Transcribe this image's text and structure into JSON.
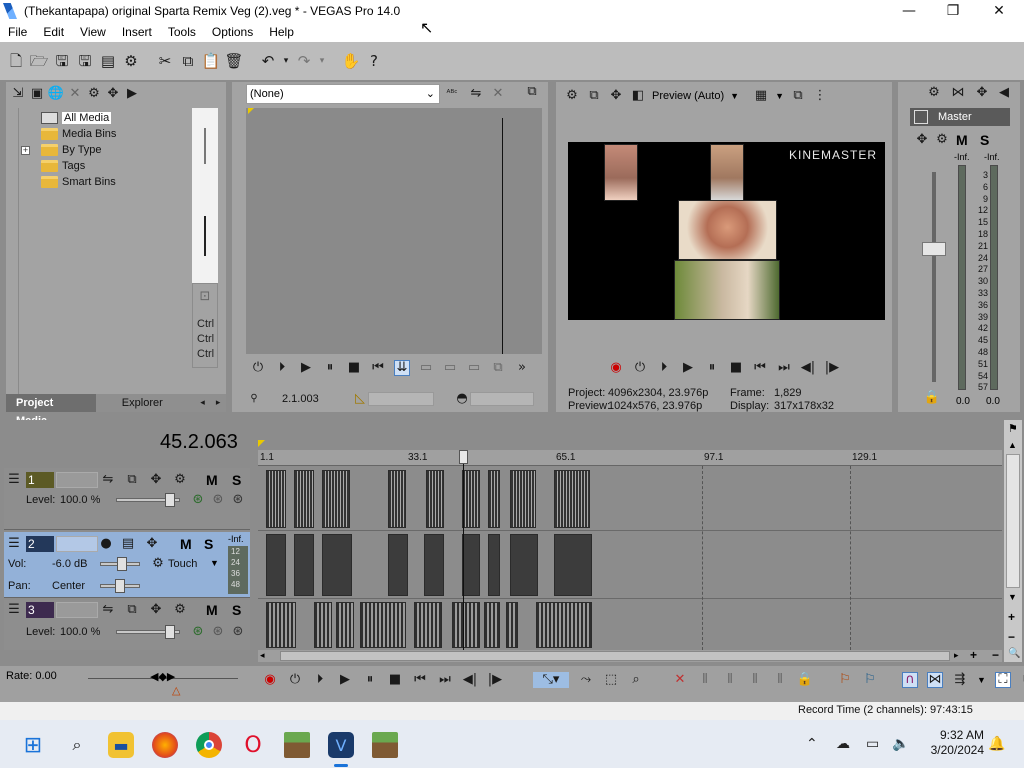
{
  "window": {
    "title": "(Thekantapapa) original Sparta Remix Veg (2).veg * - VEGAS Pro 14.0",
    "minimize": "—",
    "maximize": "❐",
    "close": "✕"
  },
  "menu": [
    "File",
    "Edit",
    "View",
    "Insert",
    "Tools",
    "Options",
    "Help"
  ],
  "toolbar_icons": [
    "new-icon",
    "open-icon",
    "save-icon",
    "save-as-icon",
    "render-icon",
    "properties-icon",
    "cut-icon",
    "copy-icon",
    "paste-icon",
    "delete-icon",
    "undo-icon",
    "redo-icon",
    "tool-hand-icon",
    "help-icon"
  ],
  "media": {
    "tree": [
      {
        "label": "All Media",
        "selected": true
      },
      {
        "label": "Media Bins"
      },
      {
        "label": "By Type",
        "expandable": true
      },
      {
        "label": "Tags"
      },
      {
        "label": "Smart Bins"
      }
    ],
    "ctrl": [
      "Ctrl",
      "Ctrl",
      "Ctrl"
    ],
    "tabs": [
      "Project Media",
      "Explorer"
    ]
  },
  "trimmer": {
    "select": "(None)",
    "timecode": "2.1.003"
  },
  "preview": {
    "mode": "Preview (Auto)",
    "watermark": "KINEMASTER",
    "project_label": "Project:",
    "project_value": "4096x2304, 23.976p",
    "preview_label": "Preview:",
    "preview_value": "1024x576, 23.976p",
    "frame_label": "Frame:",
    "frame_value": "1,829",
    "display_label": "Display:",
    "display_value": "317x178x32"
  },
  "master": {
    "label": "Master",
    "inf_left": "-Inf.",
    "inf_right": "-Inf.",
    "scale": [
      "3",
      "6",
      "9",
      "12",
      "15",
      "18",
      "21",
      "24",
      "27",
      "30",
      "33",
      "36",
      "39",
      "42",
      "45",
      "48",
      "51",
      "54",
      "57"
    ],
    "bottom_left": "0.0",
    "bottom_right": "0.0"
  },
  "timeline": {
    "time": "45.2.063",
    "ruler": [
      "1.1",
      "33.1",
      "65.1",
      "97.1",
      "129.1"
    ],
    "tracks": [
      {
        "num": "1",
        "level_label": "Level:",
        "level": "100.0 %"
      },
      {
        "num": "2",
        "vol_label": "Vol:",
        "vol": "-6.0 dB",
        "pan_label": "Pan:",
        "pan": "Center",
        "touch": "Touch",
        "inf": "-Inf.",
        "meter_scale": [
          "12",
          "24",
          "36",
          "48"
        ]
      },
      {
        "num": "3",
        "level_label": "Level:",
        "level": "100.0 %"
      }
    ],
    "rate": "Rate: 0.00",
    "record_time": "Record Time (2 channels): 97:43:15"
  },
  "taskbar": {
    "apps": [
      "start-icon",
      "search-icon",
      "file-explorer-icon",
      "firefox-icon",
      "chrome-icon",
      "opera-icon",
      "minecraft-icon",
      "vegas-icon",
      "minecraft-block-icon"
    ],
    "time": "9:32 AM",
    "date": "3/20/2024"
  }
}
